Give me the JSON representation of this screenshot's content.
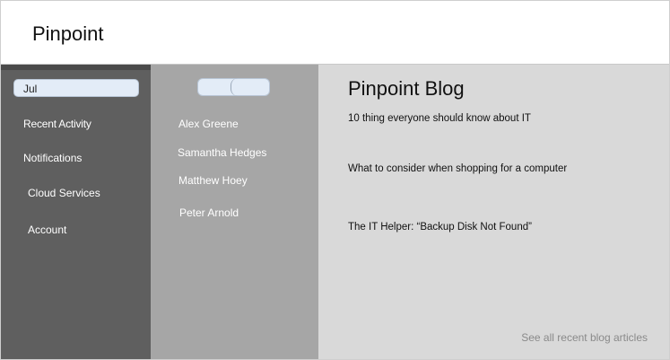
{
  "header": {
    "title": "Pinpoint"
  },
  "sidebar": {
    "month_value": "Jul",
    "items": [
      {
        "label": "Recent Activity"
      },
      {
        "label": "Notifications"
      },
      {
        "label": "Cloud Services"
      },
      {
        "label": "Account"
      }
    ]
  },
  "contacts": {
    "items": [
      {
        "name": "Alex Greene"
      },
      {
        "name": "Samantha Hedges"
      },
      {
        "name": "Matthew Hoey"
      },
      {
        "name": "Peter Arnold"
      }
    ]
  },
  "blog": {
    "title": "Pinpoint Blog",
    "articles": [
      {
        "title": "10 thing everyone should know about IT"
      },
      {
        "title": "What to consider when shopping for a computer"
      },
      {
        "title": "The IT Helper: “Backup Disk Not Found”"
      }
    ],
    "see_all_label": "See all recent blog articles"
  },
  "colors": {
    "sidebar_bg": "#5f5f5f",
    "contacts_bg": "#a6a6a6",
    "blog_bg": "#d9d9d9",
    "control_bg": "#e3ecf7"
  }
}
